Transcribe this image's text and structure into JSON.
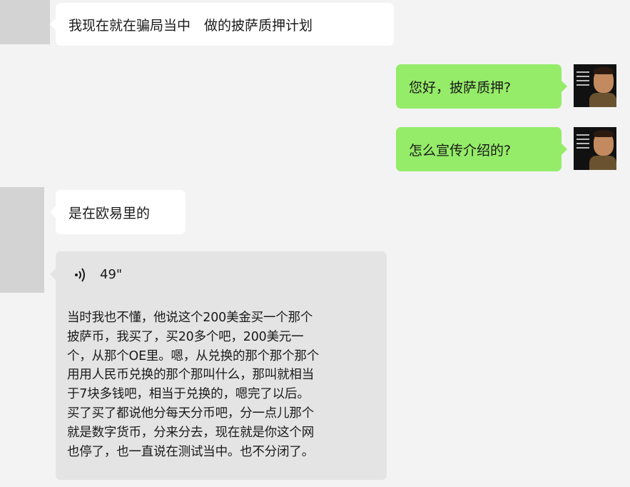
{
  "messages": [
    {
      "side": "left",
      "text": "我现在就在骗局当中　做的披萨质押计划"
    },
    {
      "side": "right",
      "text": "您好，披萨质押?"
    },
    {
      "side": "right",
      "text": "怎么宣传介绍的?"
    },
    {
      "side": "left",
      "text": "是在欧易里的"
    }
  ],
  "voice_message": {
    "duration": "49\"",
    "icon": "voice-wave-icon",
    "transcript": "当时我也不懂，他说这个200美金买一个那个\n披萨币，我买了，买20多个吧，200美元一\n个，从那个OE里。嗯，从兑换的那个那个那个\n用用人民币兑换的那个那叫什么，那叫就相当\n于7块多钱吧，相当于兑换的，嗯完了以后。\n买了买了都说他分每天分币吧，分一点儿那个\n就是数字货币，分来分去，现在就是你这个网\n也停了，也一直说在测试当中。也不分闭了。"
  },
  "colors": {
    "background": "#f3f3f3",
    "incoming_bubble": "#ffffff",
    "outgoing_bubble": "#95ec69",
    "voice_card": "#e4e4e4",
    "avatar_placeholder": "#d3d3d3"
  }
}
